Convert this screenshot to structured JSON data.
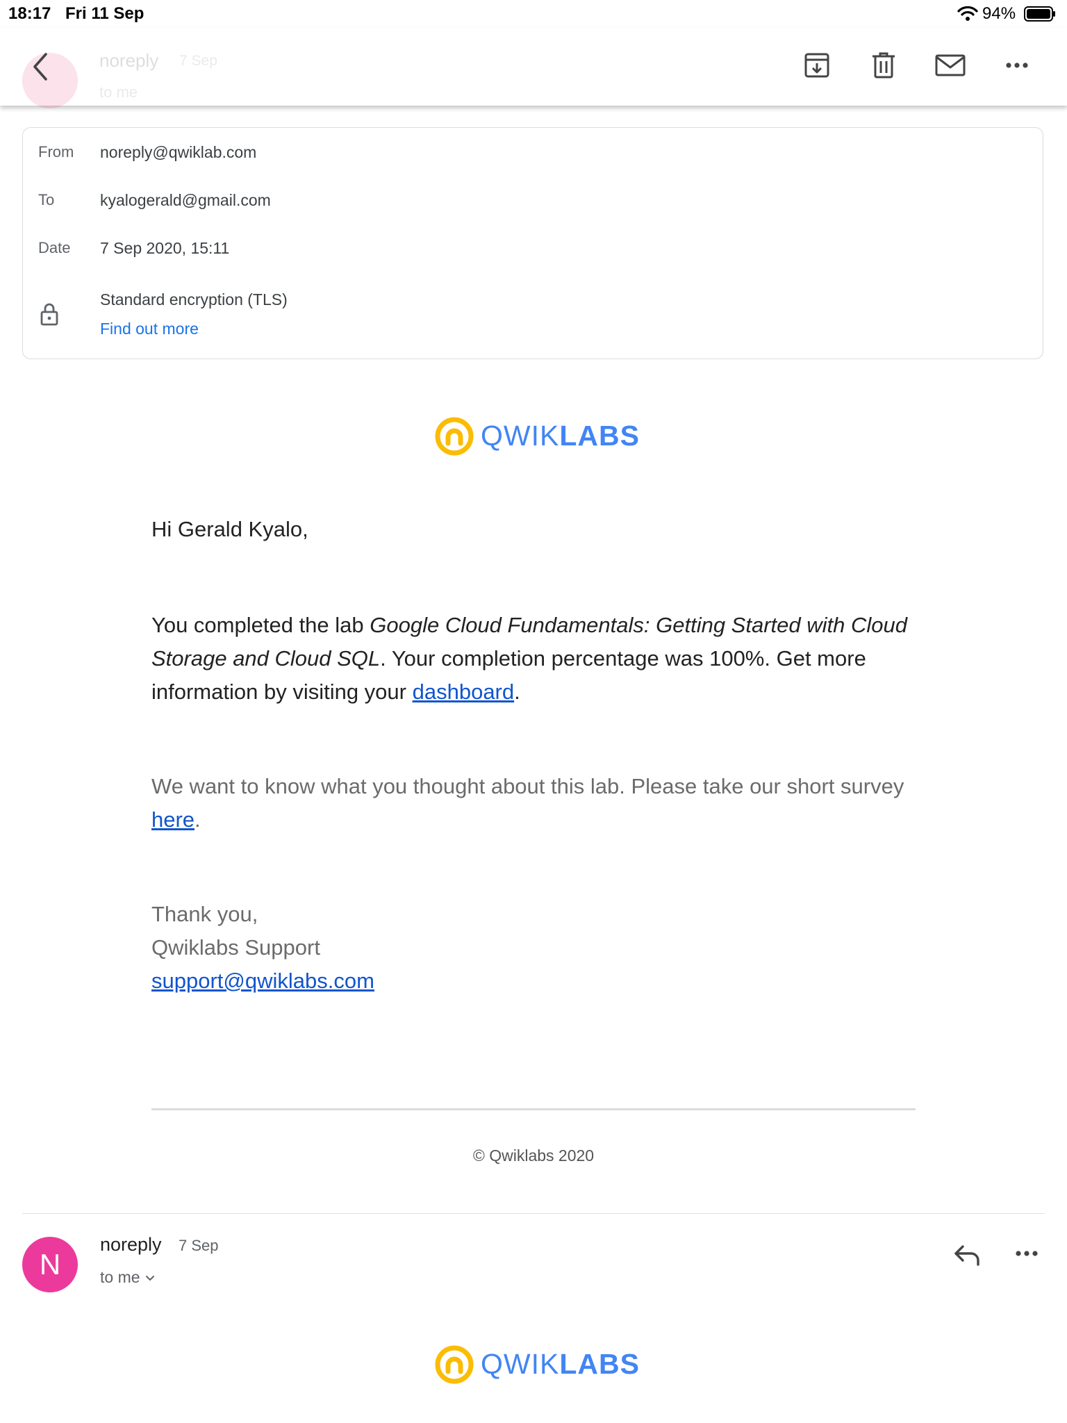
{
  "status_bar": {
    "time": "18:17",
    "date": "Fri 11 Sep",
    "battery_percent": "94%"
  },
  "toolbar": {
    "ghost_sender": "noreply",
    "ghost_date": "7 Sep",
    "ghost_to": "to me",
    "icons": [
      "back-arrow-icon",
      "archive-icon",
      "trash-icon",
      "mail-icon",
      "more-horizontal-icon"
    ]
  },
  "details": {
    "from_label": "From",
    "from_value": "noreply@qwiklab.com",
    "to_label": "To",
    "to_value": "kyalogerald@gmail.com",
    "date_label": "Date",
    "date_value": "7 Sep 2020, 15:11",
    "encryption": "Standard encryption (TLS)",
    "find_out_more": "Find out more"
  },
  "logo": {
    "part1": "QWIK",
    "part2": "LABS"
  },
  "body": {
    "greeting": "Hi Gerald Kyalo,",
    "completion_prefix": "You completed the lab ",
    "lab_name": "Google Cloud Fundamentals: Getting Started with Cloud Storage and Cloud SQL",
    "completion_middle": ". Your completion percentage was 100%. Get more information by visiting your ",
    "dashboard_link": "dashboard",
    "period": ".",
    "survey_prefix": "We want to know what you thought about this lab. Please take our short survey ",
    "survey_link": "here",
    "thanks": "Thank you,",
    "team": "Qwiklabs Support",
    "support_email": "support@qwiklabs.com",
    "copyright": "© Qwiklabs 2020"
  },
  "second_message": {
    "avatar_letter": "N",
    "sender": "noreply",
    "date": "7 Sep",
    "to": "to me"
  },
  "colors": {
    "accent_blue": "#1a73e8",
    "link_blue": "#1155cc",
    "logo_blue": "#4285f4",
    "logo_yellow": "#fbbc04",
    "avatar_pink": "#ec3a9c"
  }
}
